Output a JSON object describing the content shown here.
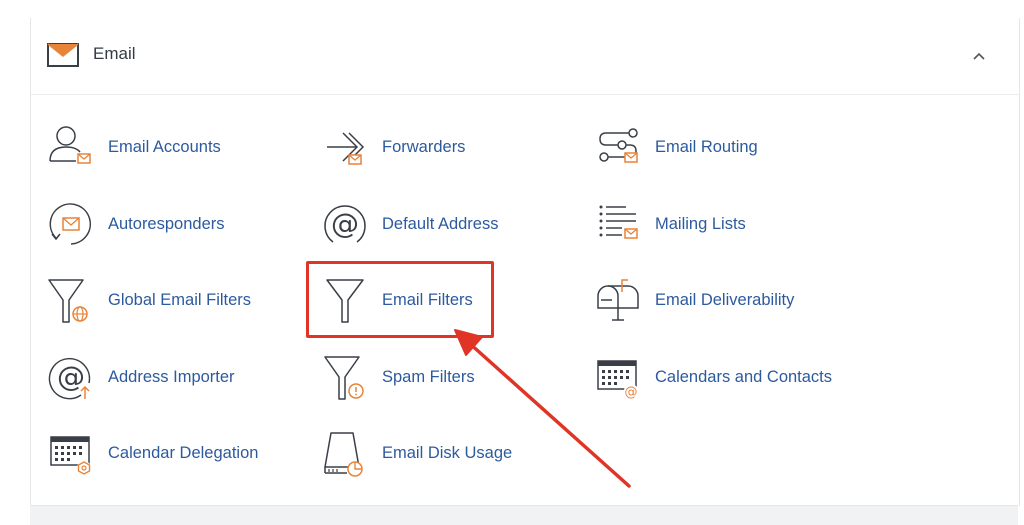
{
  "section": {
    "title": "Email",
    "collapse_icon": "chevron-up-icon",
    "items": [
      {
        "label": "Email Accounts",
        "icon": "email-accounts-icon"
      },
      {
        "label": "Forwarders",
        "icon": "forwarders-icon"
      },
      {
        "label": "Email Routing",
        "icon": "email-routing-icon"
      },
      {
        "label": "Autoresponders",
        "icon": "autoresponders-icon"
      },
      {
        "label": "Default Address",
        "icon": "default-address-icon"
      },
      {
        "label": "Mailing Lists",
        "icon": "mailing-lists-icon"
      },
      {
        "label": "Global Email Filters",
        "icon": "global-email-filters-icon"
      },
      {
        "label": "Email Filters",
        "icon": "email-filters-icon"
      },
      {
        "label": "Email Deliverability",
        "icon": "email-deliverability-icon"
      },
      {
        "label": "Address Importer",
        "icon": "address-importer-icon"
      },
      {
        "label": "Spam Filters",
        "icon": "spam-filters-icon"
      },
      {
        "label": "Calendars and Contacts",
        "icon": "calendars-contacts-icon"
      },
      {
        "label": "Calendar Delegation",
        "icon": "calendar-delegation-icon"
      },
      {
        "label": "Email Disk Usage",
        "icon": "email-disk-usage-icon"
      }
    ]
  },
  "colors": {
    "icon_stroke": "#3a3f47",
    "accent": "#e8843a",
    "link": "#2d5a9e",
    "highlight": "#e03526"
  }
}
